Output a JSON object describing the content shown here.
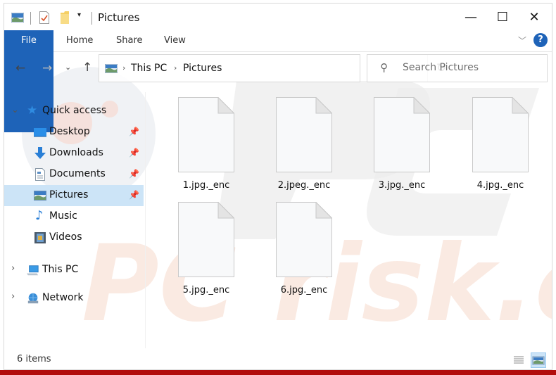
{
  "window": {
    "title": "Pictures",
    "controls": {
      "minimize": "—",
      "maximize": "☐",
      "close": "✕"
    }
  },
  "quick_access_toolbar": {
    "icons": [
      "pictures-app-icon",
      "properties-icon",
      "new-folder-icon",
      "customize-dropdown-icon"
    ]
  },
  "ribbon": {
    "tabs": [
      {
        "label": "File",
        "active": true
      },
      {
        "label": "Home"
      },
      {
        "label": "Share"
      },
      {
        "label": "View"
      }
    ],
    "help_label": "?",
    "accent": "#1e63b8"
  },
  "address_bar": {
    "breadcrumb": [
      "This PC",
      "Pictures"
    ],
    "separator": "›"
  },
  "search": {
    "placeholder": "Search Pictures",
    "value": ""
  },
  "nav_pane": {
    "quick_access": {
      "label": "Quick access",
      "expanded": true
    },
    "items": [
      {
        "label": "Desktop",
        "icon": "desktop-icon",
        "pinned": true
      },
      {
        "label": "Downloads",
        "icon": "downloads-icon",
        "pinned": true
      },
      {
        "label": "Documents",
        "icon": "documents-icon",
        "pinned": true
      },
      {
        "label": "Pictures",
        "icon": "pictures-icon",
        "pinned": true,
        "selected": true
      },
      {
        "label": "Music",
        "icon": "music-icon",
        "pinned": false
      },
      {
        "label": "Videos",
        "icon": "videos-icon",
        "pinned": false
      }
    ],
    "this_pc": {
      "label": "This PC",
      "expanded": false
    },
    "network": {
      "label": "Network",
      "expanded": false
    },
    "selection_color": "#cce4f7"
  },
  "files": [
    {
      "name": "1.jpg._enc"
    },
    {
      "name": "2.jpeg._enc"
    },
    {
      "name": "3.jpg._enc"
    },
    {
      "name": "4.jpg._enc"
    },
    {
      "name": "5.jpg._enc"
    },
    {
      "name": "6.jpg._enc"
    }
  ],
  "status_bar": {
    "item_count": "6 items",
    "view_modes": [
      {
        "name": "details-view"
      },
      {
        "name": "large-icons-view",
        "active": true
      }
    ]
  },
  "watermark": {
    "text": "PC risk.com"
  }
}
